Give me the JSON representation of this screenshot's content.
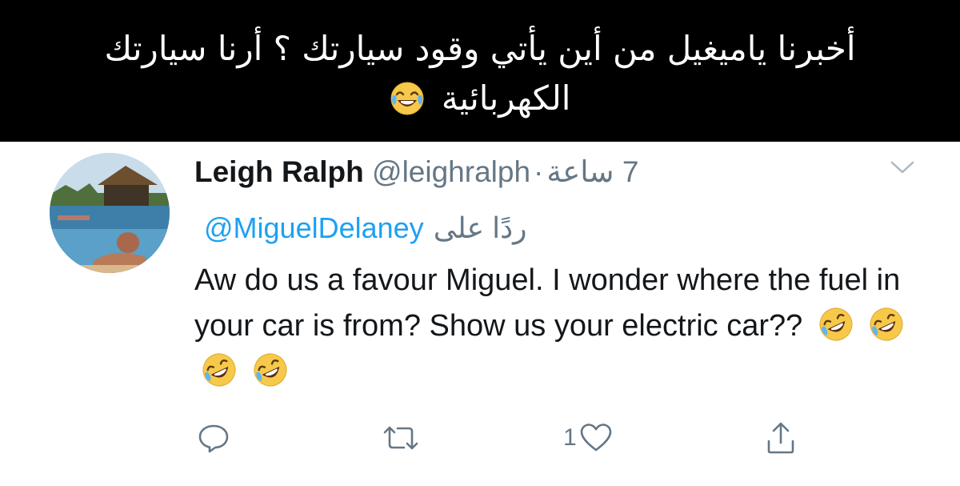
{
  "caption": {
    "text": "أخبرنا ياميغيل من أين يأتي وقود سيارتك ؟ أرنا سيارتك الكهربائية",
    "emoji": "face-with-tears-of-joy"
  },
  "tweet": {
    "display_name": "Leigh Ralph",
    "handle": "@leighralph",
    "separator": "·",
    "time": "7 ساعة",
    "replying_to_label": "ردًا على",
    "replying_to_handle": "@MiguelDelaney",
    "body": "Aw do us a favour Miguel. I wonder where the fuel in your car is from? Show us your electric car??",
    "body_emoji": [
      "rolling-on-the-floor-laughing",
      "rolling-on-the-floor-laughing",
      "rolling-on-the-floor-laughing",
      "rolling-on-the-floor-laughing"
    ],
    "like_count": "1"
  },
  "icons": {
    "menu": "chevron-down-icon",
    "reply": "reply-icon",
    "retweet": "retweet-icon",
    "like": "heart-icon",
    "share": "share-icon"
  },
  "colors": {
    "caption_background": "#000000",
    "caption_text": "#ffffff",
    "link": "#1da1f2",
    "secondary_text": "#657786",
    "primary_text": "#14171a",
    "icon": "#657786"
  }
}
